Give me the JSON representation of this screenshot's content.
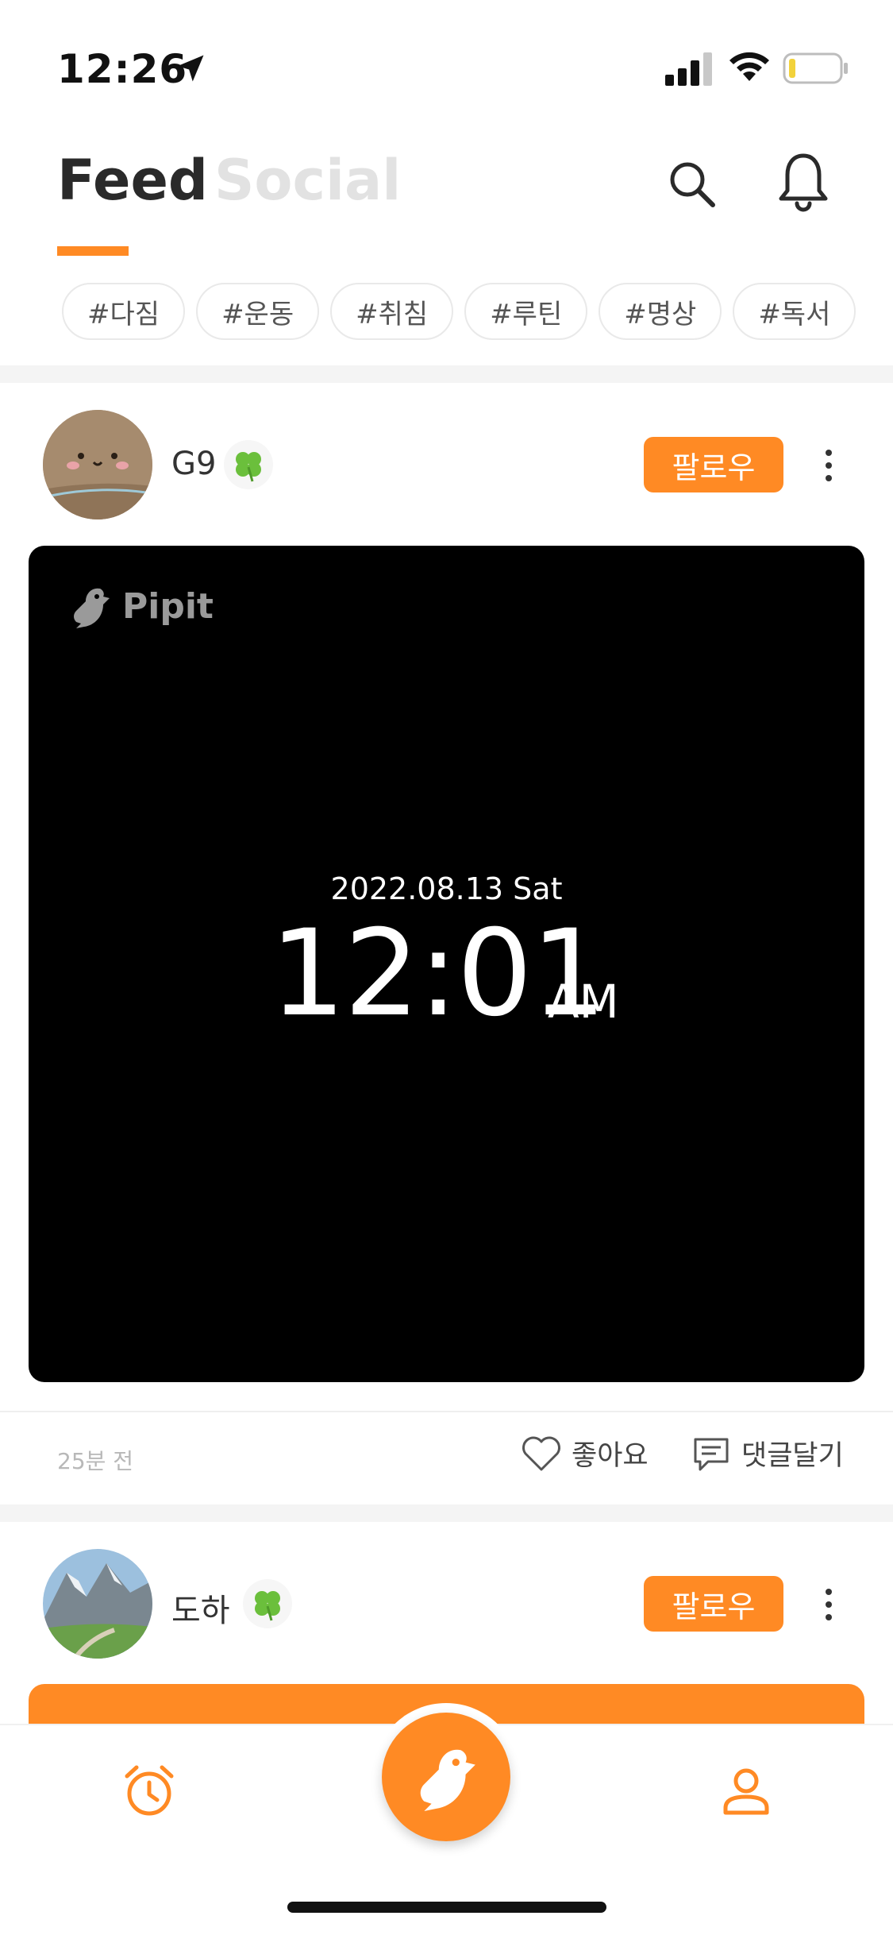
{
  "status_bar": {
    "time": "12:26"
  },
  "header": {
    "tab_feed": "Feed",
    "tab_social": "Social"
  },
  "hashtags": [
    "#다짐",
    "#운동",
    "#취침",
    "#루틴",
    "#명상",
    "#독서"
  ],
  "posts": [
    {
      "username": "G9",
      "follow_label": "팔로우",
      "image": {
        "logo_text": "Pipit",
        "date": "2022.08.13 Sat",
        "time": "12:01",
        "ampm": "AM"
      },
      "time_ago": "25분 전",
      "like_label": "좋아요",
      "comment_label": "댓글달기"
    },
    {
      "username": "도하",
      "follow_label": "팔로우"
    }
  ],
  "colors": {
    "accent": "#ff8a24",
    "inactive_tab": "#e2e2e2",
    "image_bg": "#000000"
  },
  "icons": [
    "location-arrow-icon",
    "signal-icon",
    "wifi-icon",
    "battery-icon",
    "search-icon",
    "bell-icon",
    "clover-icon",
    "more-vertical-icon",
    "heart-icon",
    "comment-icon",
    "alarm-clock-icon",
    "bird-icon",
    "profile-icon"
  ]
}
